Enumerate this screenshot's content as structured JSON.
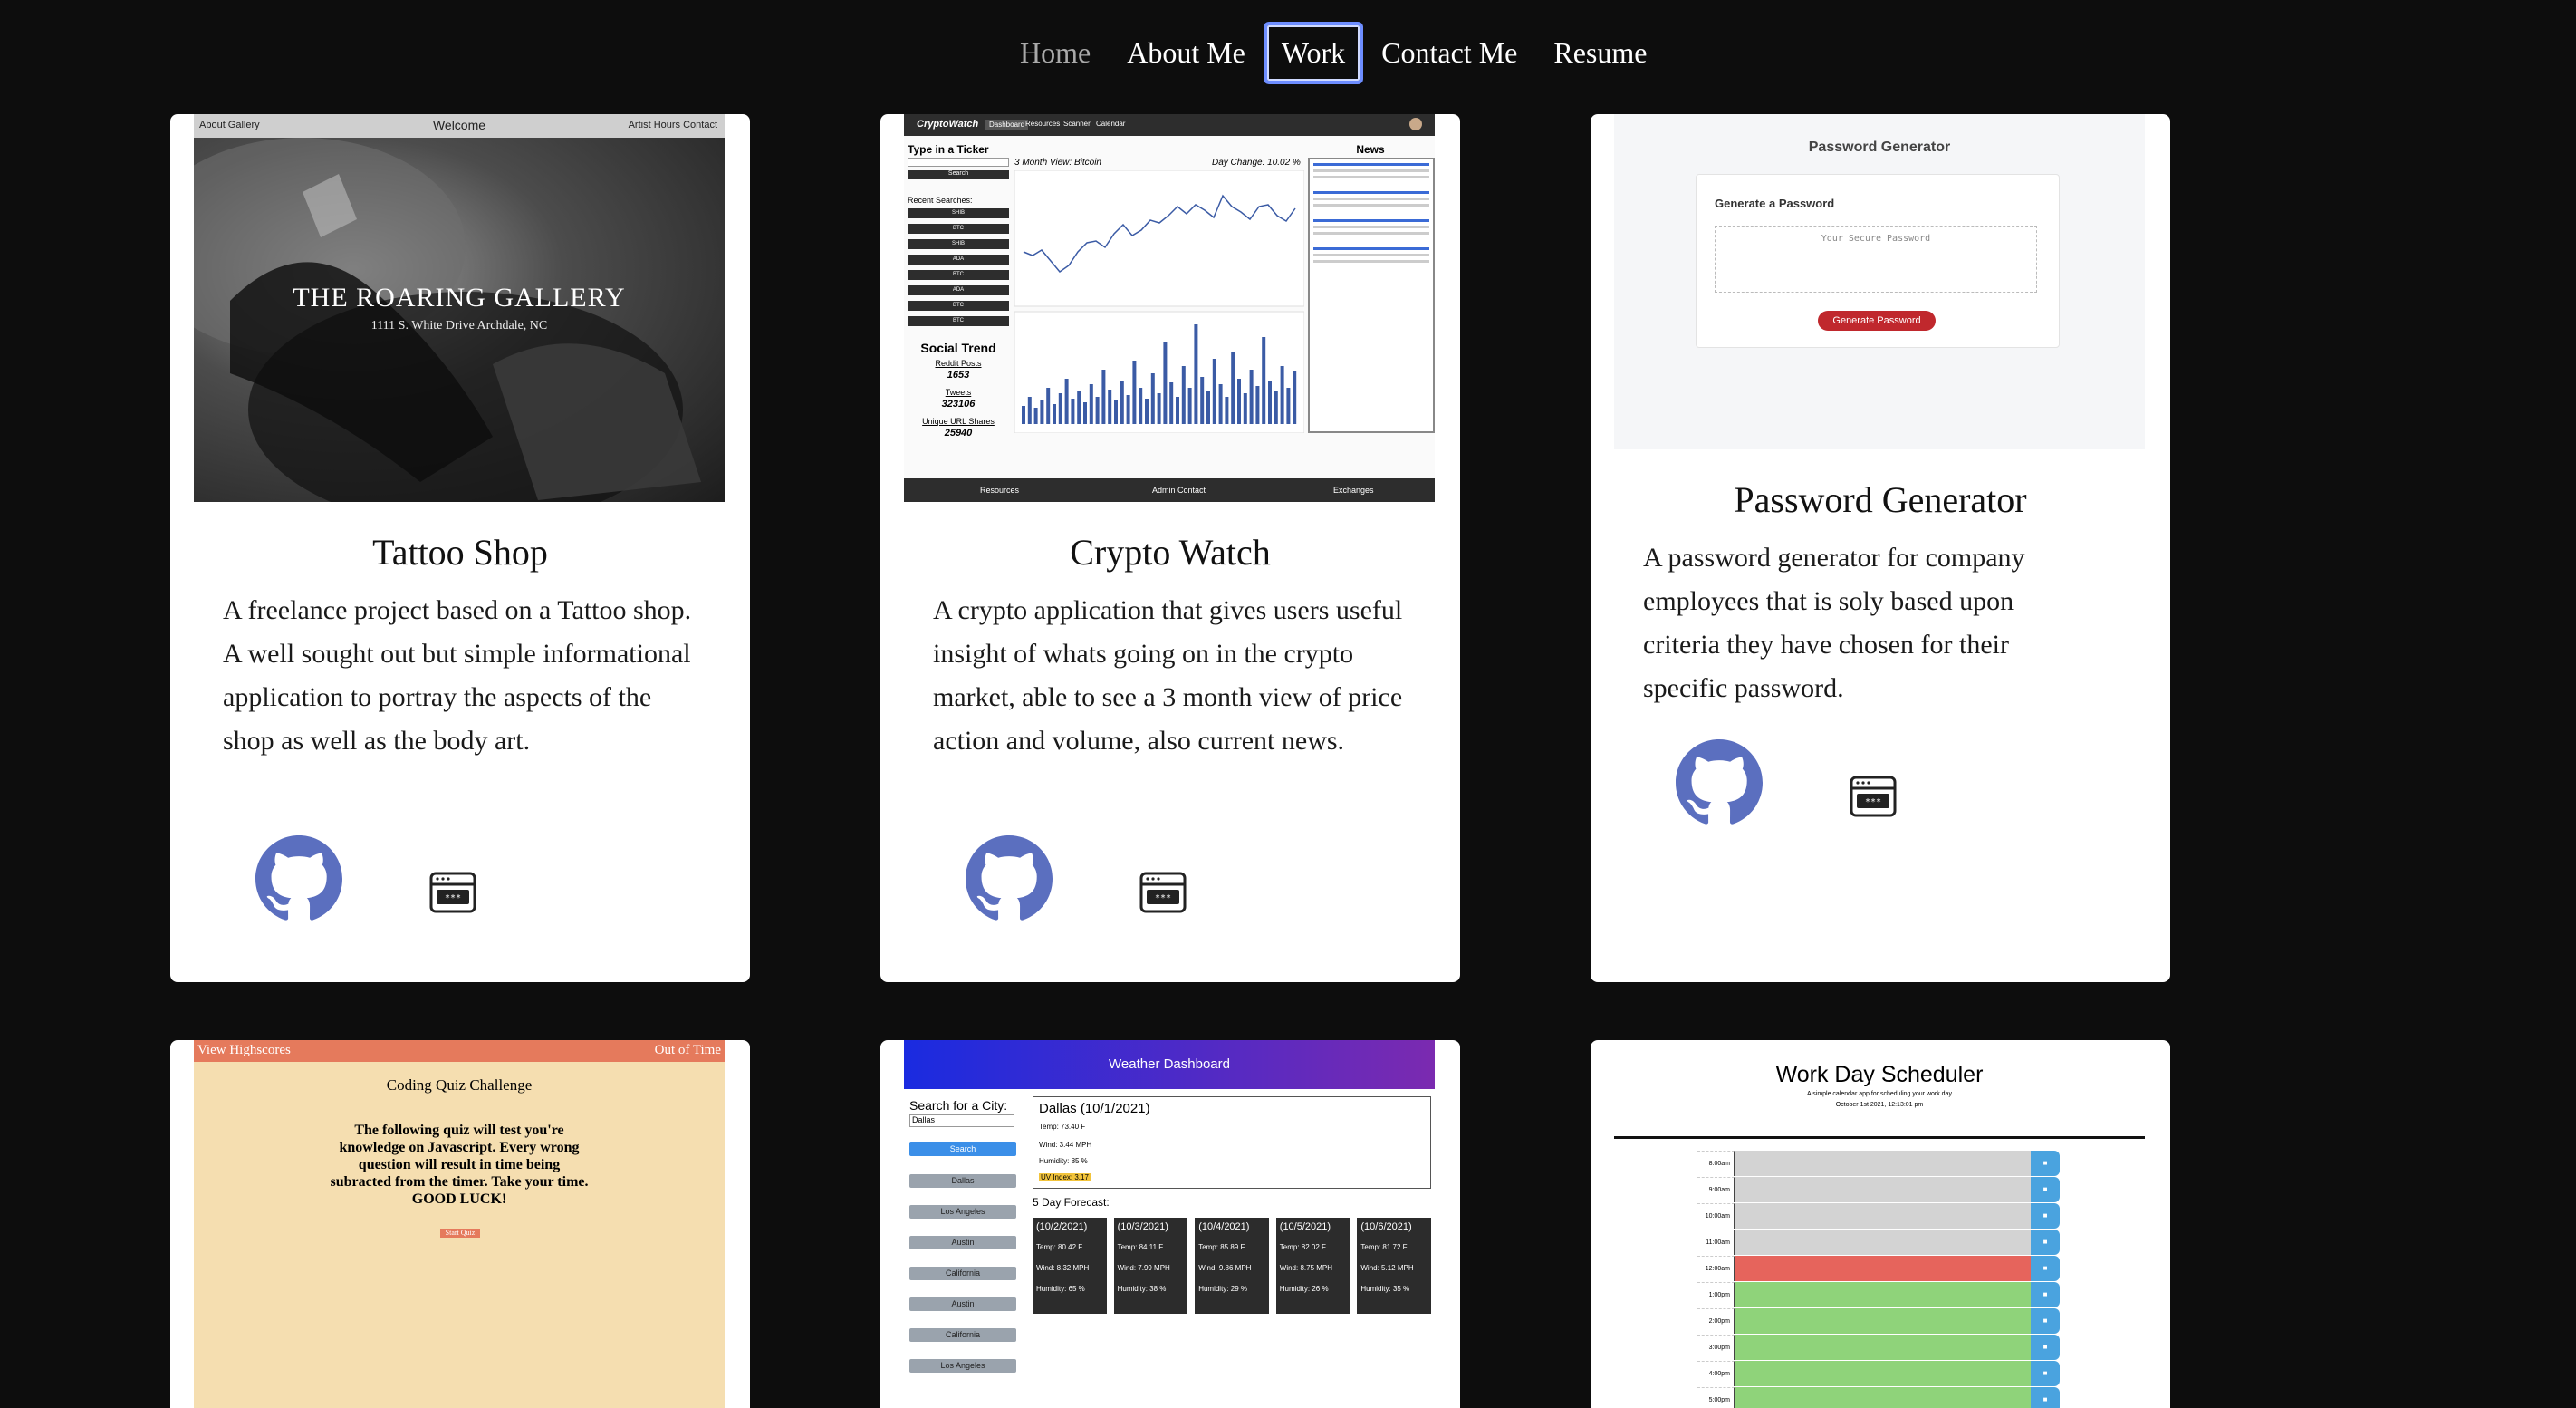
{
  "nav": {
    "items": [
      "Home",
      "About Me",
      "Work",
      "Contact Me",
      "Resume"
    ],
    "active": "Work"
  },
  "projects": [
    {
      "title": "Tattoo Shop",
      "description": "A freelance project based on a Tattoo shop. A well sought out but simple informational application to portray the aspects of the shop as well as the body art.",
      "screenshot": {
        "nav_left": "About   Gallery",
        "nav_center": "Welcome",
        "nav_right": "Artist   Hours   Contact",
        "headline": "THE ROARING GALLERY",
        "address": "1111 S. White Drive Archdale, NC"
      }
    },
    {
      "title": "Crypto Watch",
      "description": "A crypto application that gives users useful insight of whats going on in the crypto market, able to see a 3 month view of price action and volume, also current news.",
      "screenshot": {
        "brand": "CryptoWatch",
        "tabs": [
          "Dashboard",
          "Resources",
          "Scanner",
          "Calendar"
        ],
        "ticker_label": "Type in a Ticker",
        "search_btn": "Search",
        "recent_label": "Recent Searches:",
        "recent": [
          "SHIB",
          "BTC",
          "SHIB",
          "ADA",
          "BTC",
          "ADA",
          "BTC",
          "BTC"
        ],
        "view_label": "3 Month View: Bitcoin",
        "day_change": "Day Change: 10.02 %",
        "social_title": "Social Trend",
        "reddit_label": "Reddit Posts",
        "reddit_value": "1653",
        "tweets_label": "Tweets",
        "tweets_value": "323106",
        "url_label": "Unique URL Shares",
        "url_value": "25940",
        "news_title": "News",
        "footer": [
          "Resources",
          "Admin Contact",
          "Exchanges"
        ]
      }
    },
    {
      "title": "Password Generator",
      "description": "A password generator for company employees that is soly based upon criteria they have chosen for their specific password.",
      "screenshot": {
        "heading": "Password Generator",
        "sub": "Generate a Password",
        "placeholder": "Your Secure Password",
        "button": "Generate Password"
      }
    },
    {
      "screenshot": {
        "left": "View Highscores",
        "right": "Out of Time",
        "title": "Coding Quiz Challenge",
        "body": "The following quiz will test you're knowledge on Javascript. Every wrong question will result in time being subracted from the timer. Take your time. GOOD LUCK!",
        "button": "Start Quiz"
      }
    },
    {
      "screenshot": {
        "header": "Weather Dashboard",
        "search_label": "Search for a City:",
        "search_value": "Dallas",
        "search_btn": "Search",
        "cities": [
          "Dallas",
          "Los Angeles",
          "Austin",
          "California",
          "Austin",
          "California",
          "Los Angeles"
        ],
        "current_title": "Dallas (10/1/2021)",
        "current": [
          "Temp: 73.40 F",
          "Wind: 3.44 MPH",
          "Humidity: 85 %",
          "UV Index: 3.17"
        ],
        "forecast_label": "5 Day Forecast:",
        "forecast": [
          {
            "date": "(10/2/2021)",
            "temp": "Temp: 80.42 F",
            "wind": "Wind: 8.32 MPH",
            "hum": "Humidity: 65 %"
          },
          {
            "date": "(10/3/2021)",
            "temp": "Temp: 84.11 F",
            "wind": "Wind: 7.99 MPH",
            "hum": "Humidity: 38 %"
          },
          {
            "date": "(10/4/2021)",
            "temp": "Temp: 85.89 F",
            "wind": "Wind: 9.86 MPH",
            "hum": "Humidity: 29 %"
          },
          {
            "date": "(10/5/2021)",
            "temp": "Temp: 82.02 F",
            "wind": "Wind: 8.75 MPH",
            "hum": "Humidity: 26 %"
          },
          {
            "date": "(10/6/2021)",
            "temp": "Temp: 81.72 F",
            "wind": "Wind: 5.12 MPH",
            "hum": "Humidity: 35 %"
          }
        ]
      }
    },
    {
      "screenshot": {
        "title": "Work Day Scheduler",
        "sub": "A simple calendar app for scheduling your work day",
        "date": "October 1st 2021, 12:13:01 pm",
        "hours": [
          "8:00am",
          "9:00am",
          "10:00am",
          "11:00am",
          "12:00am",
          "1:00pm",
          "2:00pm",
          "3:00pm",
          "4:00pm",
          "5:00pm"
        ],
        "states": [
          "past",
          "past",
          "past",
          "past",
          "present",
          "future",
          "future",
          "future",
          "future",
          "future"
        ]
      }
    }
  ],
  "colors": {
    "background": "#0d0d0d",
    "github": "#5b6fbf",
    "nav_active_border": "#6d8dff"
  }
}
